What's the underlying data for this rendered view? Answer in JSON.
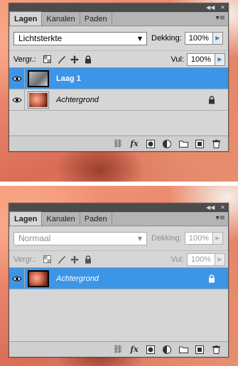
{
  "panel_top": {
    "tabs": [
      "Lagen",
      "Kanalen",
      "Paden"
    ],
    "blend_mode": "Lichtsterkte",
    "opacity_label": "Dekking:",
    "opacity_value": "100%",
    "lock_label": "Vergr.:",
    "fill_label": "Vul:",
    "fill_value": "100%",
    "layers": [
      {
        "name": "Laag 1",
        "selected": true,
        "locked": false,
        "thumb": "gray"
      },
      {
        "name": "Achtergrond",
        "selected": false,
        "locked": true,
        "thumb": "color"
      }
    ]
  },
  "panel_bottom": {
    "tabs": [
      "Lagen",
      "Kanalen",
      "Paden"
    ],
    "blend_mode": "Normaal",
    "opacity_label": "Dekking:",
    "opacity_value": "100%",
    "lock_label": "Vergr.:",
    "fill_label": "Vul:",
    "fill_value": "100%",
    "layers": [
      {
        "name": "Achtergrond",
        "selected": true,
        "locked": true,
        "thumb": "color"
      }
    ]
  },
  "colors": {
    "selection": "#3d95e8",
    "panel_bg": "#d6d6d6",
    "titlebar": "#4c4c4c"
  },
  "icons": [
    "link-icon",
    "fx-icon",
    "mask-icon",
    "adjustment-icon",
    "folder-icon",
    "new-layer-icon",
    "trash-icon"
  ]
}
